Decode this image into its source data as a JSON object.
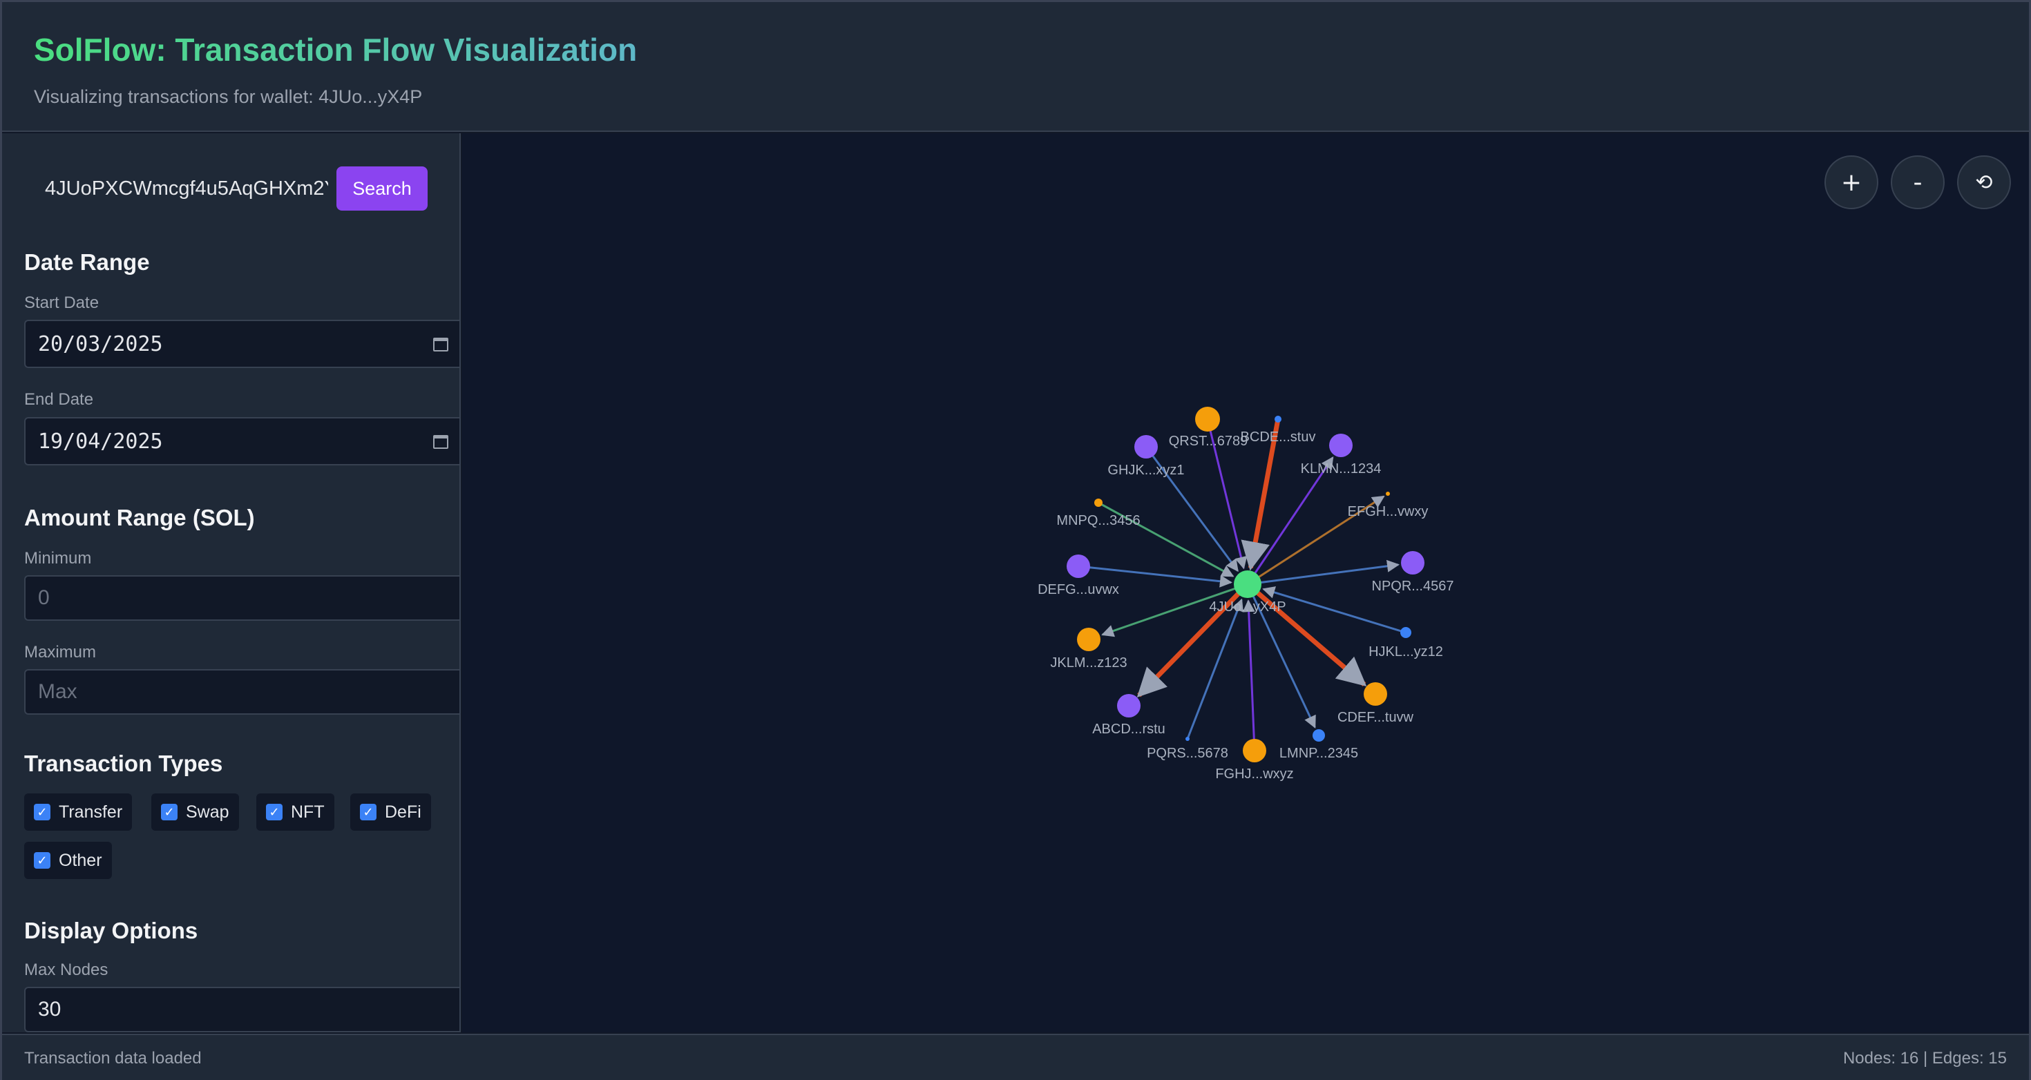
{
  "header": {
    "title": "SolFlow: Transaction Flow Visualization",
    "subtitle": "Visualizing transactions for wallet: 4JUo...yX4P"
  },
  "search": {
    "value": "4JUoPXCWmcgf4u5AqGHXm2Y",
    "button_label": "Search"
  },
  "date_range": {
    "title": "Date Range",
    "start_label": "Start Date",
    "start_value": "20/03/2025",
    "end_label": "End Date",
    "end_value": "19/04/2025"
  },
  "amount_range": {
    "title": "Amount Range (SOL)",
    "min_label": "Minimum",
    "min_placeholder": "0",
    "max_label": "Maximum",
    "max_placeholder": "Max"
  },
  "transaction_types": {
    "title": "Transaction Types",
    "items": [
      {
        "label": "Transfer",
        "checked": true
      },
      {
        "label": "Swap",
        "checked": true
      },
      {
        "label": "NFT",
        "checked": true
      },
      {
        "label": "DeFi",
        "checked": true
      },
      {
        "label": "Other",
        "checked": true
      }
    ]
  },
  "display_options": {
    "title": "Display Options",
    "max_nodes_label": "Max Nodes",
    "max_nodes_value": "30"
  },
  "graph_controls": {
    "zoom_in": "+",
    "zoom_out": "-",
    "reset": "⟲"
  },
  "graph": {
    "center": {
      "label": "4JUo...yX4P",
      "color": "#4ade80"
    },
    "nodes": [
      {
        "label": "QRST...6789",
        "color": "#f59e0b"
      },
      {
        "label": "BCDE...stuv",
        "color": "#3b82f6"
      },
      {
        "label": "GHJK...xyz1",
        "color": "#8b5cf6"
      },
      {
        "label": "KLMN...1234",
        "color": "#8b5cf6"
      },
      {
        "label": "MNPQ...3456",
        "color": "#f59e0b"
      },
      {
        "label": "EFGH...vwxy",
        "color": "#f59e0b"
      },
      {
        "label": "DEFG...uvwx",
        "color": "#8b5cf6"
      },
      {
        "label": "NPQR...4567",
        "color": "#8b5cf6"
      },
      {
        "label": "JKLM...z123",
        "color": "#f59e0b"
      },
      {
        "label": "HJKL...yz12",
        "color": "#3b82f6"
      },
      {
        "label": "ABCD...rstu",
        "color": "#8b5cf6"
      },
      {
        "label": "CDEF...tuvw",
        "color": "#f59e0b"
      },
      {
        "label": "PQRS...5678",
        "color": "#3b82f6"
      },
      {
        "label": "FGHJ...wxyz",
        "color": "#f59e0b"
      },
      {
        "label": "LMNP...2345",
        "color": "#3b82f6"
      }
    ]
  },
  "status": {
    "left": "Transaction data loaded",
    "right": "Nodes: 16 | Edges: 15"
  }
}
